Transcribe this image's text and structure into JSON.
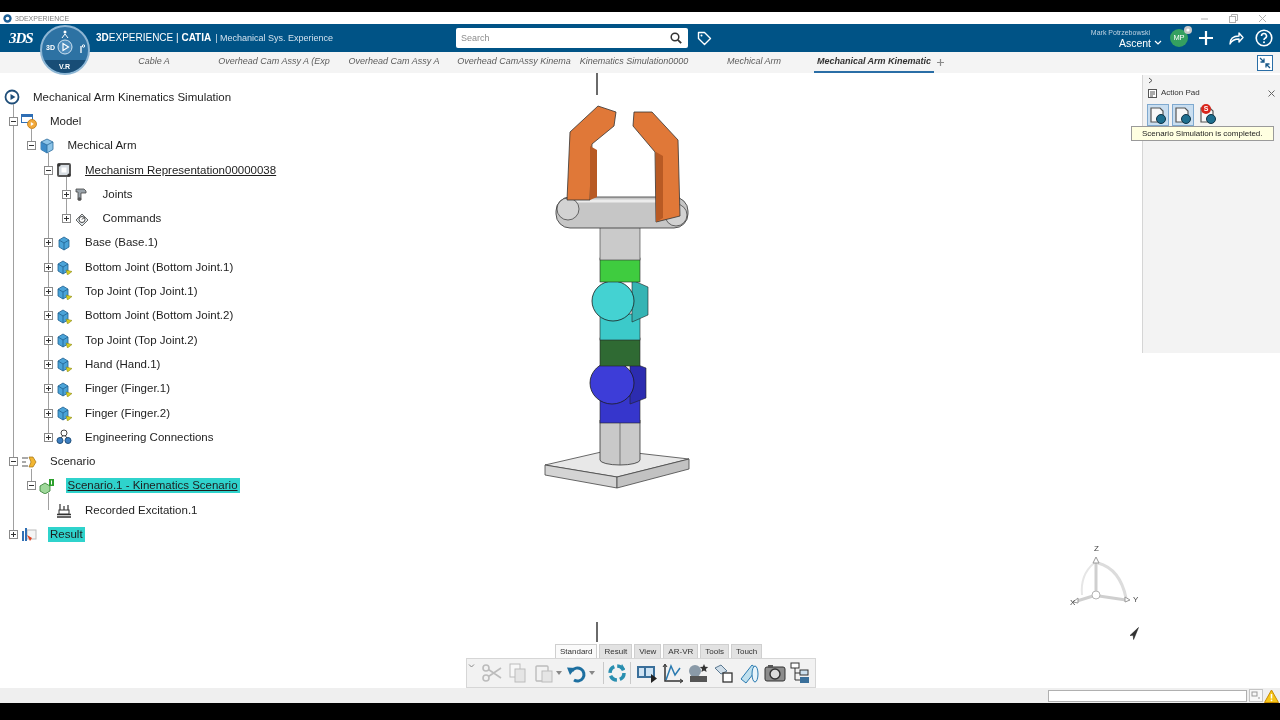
{
  "title_bar": {
    "title": "3DEXPERIENCE"
  },
  "header": {
    "logo": "3DS",
    "compass": {
      "left_label": "3D",
      "bottom_label": "V.R"
    },
    "brand": "**3D**EXPERIENCE | **CATIA**",
    "app": "| Mechanical Sys. Experience",
    "search": {
      "placeholder": "Search"
    },
    "user": {
      "name": "Mark Potrzebowski",
      "workspace": "Ascent",
      "initials": "MP"
    }
  },
  "tabs": [
    {
      "label": "Cable A",
      "selected": false
    },
    {
      "label": "Overhead Cam Assy A (Exp",
      "selected": false
    },
    {
      "label": "Overhead Cam Assy A",
      "selected": false
    },
    {
      "label": "Overhead CamAssy Kinema",
      "selected": false
    },
    {
      "label": "Kinematics Simulation0000",
      "selected": false
    },
    {
      "label": "Mechical Arm",
      "selected": false
    },
    {
      "label": "Mechanical Arm Kinematic",
      "selected": true
    }
  ],
  "tree": {
    "label": "Mechanical Arm Kinematics Simulation",
    "kind": "simulation",
    "selected": false,
    "active": false,
    "children": [
      {
        "label": "Model",
        "kind": "model",
        "expanded": true,
        "selected": false,
        "active": false,
        "children": [
          {
            "label": "Mechical Arm",
            "kind": "product",
            "expanded": true,
            "selected": false,
            "active": false,
            "children": [
              {
                "label": "Mechanism Representation00000038",
                "kind": "mechanism",
                "expanded": true,
                "selected": false,
                "active": true,
                "children": [
                  {
                    "label": "Joints",
                    "kind": "joints",
                    "expanded": false,
                    "selected": false,
                    "active": false
                  },
                  {
                    "label": "Commands",
                    "kind": "commands",
                    "expanded": false,
                    "selected": false,
                    "active": false
                  }
                ]
              },
              {
                "label": "Base (Base.1)",
                "kind": "part",
                "expanded": false,
                "selected": false,
                "active": false
              },
              {
                "label": "Bottom Joint (Bottom Joint.1)",
                "kind": "kinpart",
                "expanded": false,
                "selected": false,
                "active": false
              },
              {
                "label": "Top Joint (Top Joint.1)",
                "kind": "kinpart",
                "expanded": false,
                "selected": false,
                "active": false
              },
              {
                "label": "Bottom Joint (Bottom Joint.2)",
                "kind": "kinpart",
                "expanded": false,
                "selected": false,
                "active": false
              },
              {
                "label": "Top Joint (Top Joint.2)",
                "kind": "kinpart",
                "expanded": false,
                "selected": false,
                "active": false
              },
              {
                "label": "Hand (Hand.1)",
                "kind": "kinpart",
                "expanded": false,
                "selected": false,
                "active": false
              },
              {
                "label": "Finger (Finger.1)",
                "kind": "kinpart",
                "expanded": false,
                "selected": false,
                "active": false
              },
              {
                "label": "Finger (Finger.2)",
                "kind": "kinpart",
                "expanded": false,
                "selected": false,
                "active": false
              },
              {
                "label": "Engineering Connections",
                "kind": "connections",
                "expanded": false,
                "selected": false,
                "active": false
              }
            ]
          }
        ]
      },
      {
        "label": "Scenario",
        "kind": "scenario",
        "expanded": true,
        "selected": false,
        "active": false,
        "children": [
          {
            "label": "Scenario.1 - Kinematics Scenario",
            "kind": "kinscenario",
            "expanded": true,
            "selected": true,
            "active": true,
            "children": [
              {
                "label": "Recorded Excitation.1",
                "kind": "excitation",
                "selected": false,
                "active": false
              }
            ]
          }
        ]
      },
      {
        "label": "Result",
        "kind": "result",
        "expanded": false,
        "selected": true,
        "active": false
      }
    ]
  },
  "viewport": {
    "axis_labels": [
      "Z",
      "X",
      "Y"
    ]
  },
  "action_pad": {
    "title": "Action Pad",
    "buttons": [
      {
        "selected": true
      },
      {
        "selected": true
      },
      {
        "selected": false,
        "badge": "S"
      }
    ],
    "tooltip": "Scenario Simulation is completed."
  },
  "toolbar": {
    "sections": [
      {
        "label": "Standard",
        "selected": true
      },
      {
        "label": "Result",
        "selected": false
      },
      {
        "label": "View",
        "selected": false
      },
      {
        "label": "AR-VR",
        "selected": false
      },
      {
        "label": "Tools",
        "selected": false
      },
      {
        "label": "Touch",
        "selected": false
      }
    ],
    "tool_groups": [
      [
        {
          "kind": "cut",
          "disabled": true
        },
        {
          "kind": "copy",
          "disabled": true
        },
        {
          "kind": "paste",
          "disabled": true,
          "menu": true
        },
        {
          "kind": "undo",
          "disabled": false,
          "menu": true
        }
      ],
      [
        {
          "kind": "update",
          "disabled": false
        }
      ],
      [
        {
          "kind": "player",
          "disabled": false
        },
        {
          "kind": "plot",
          "disabled": false
        },
        {
          "kind": "sensor",
          "disabled": false
        },
        {
          "kind": "squares",
          "disabled": false
        },
        {
          "kind": "lens",
          "disabled": false
        },
        {
          "kind": "camera",
          "disabled": false
        },
        {
          "kind": "group",
          "disabled": false
        }
      ]
    ]
  }
}
